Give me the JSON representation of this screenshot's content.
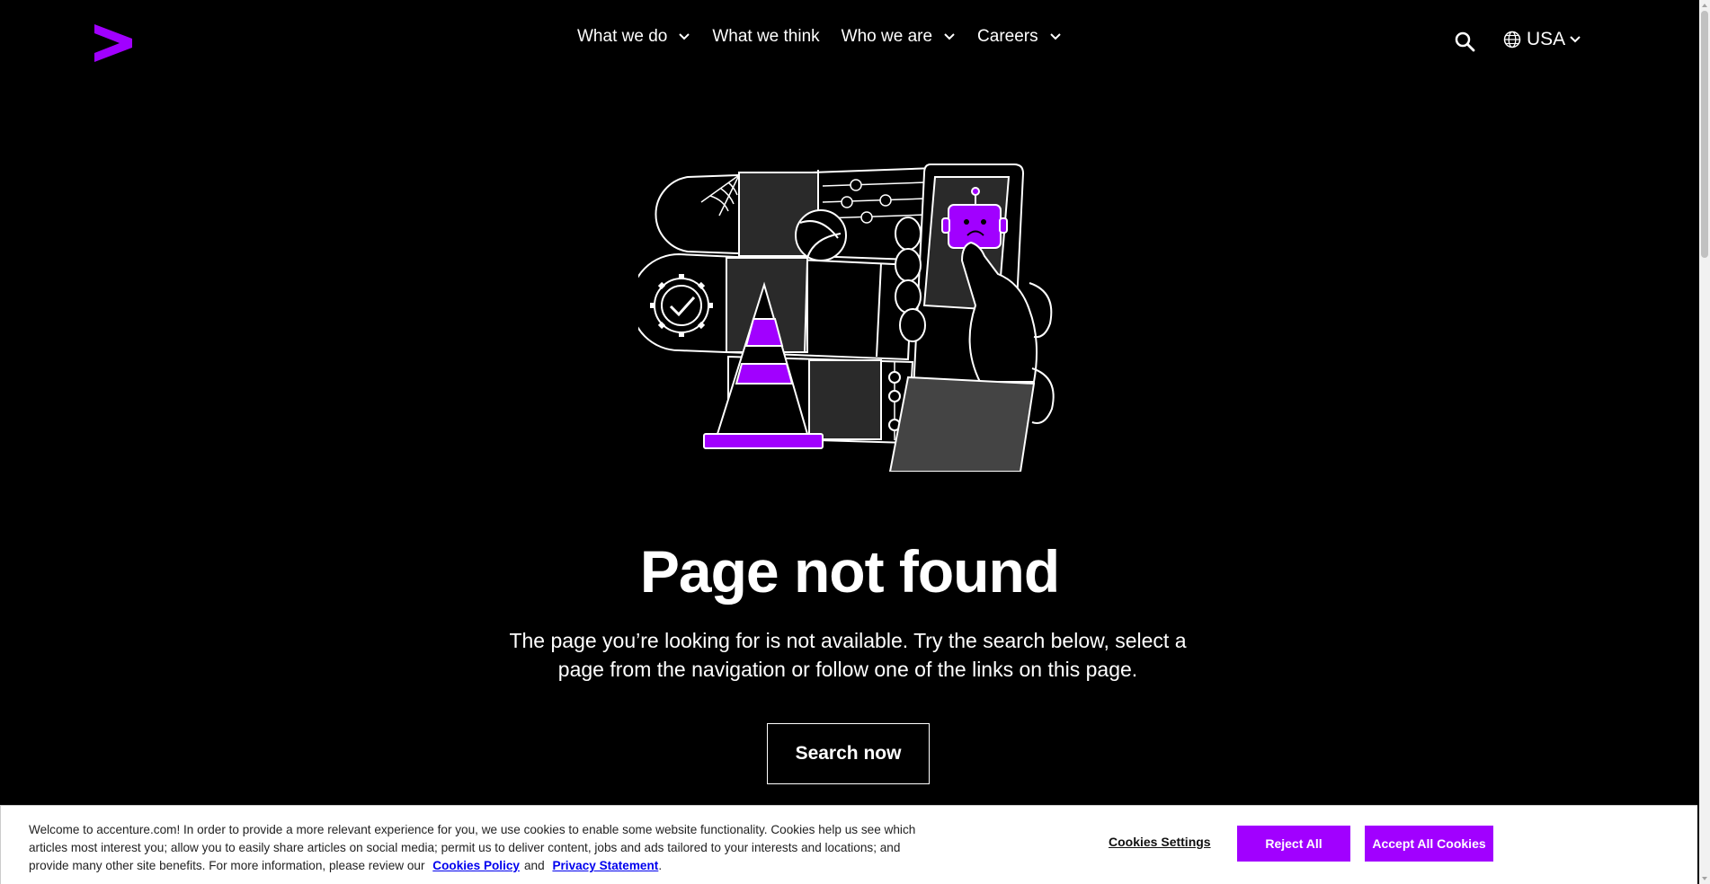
{
  "header": {
    "nav": [
      {
        "label": "What we do",
        "has_dropdown": true
      },
      {
        "label": "What we think",
        "has_dropdown": false
      },
      {
        "label": "Who we are",
        "has_dropdown": true
      },
      {
        "label": "Careers",
        "has_dropdown": true
      }
    ],
    "locale": "USA"
  },
  "main": {
    "title": "Page not found",
    "description": "The page you’re looking for is not available. Try the search below, select a page from the navigation or follow one of the links on this page.",
    "search_button": "Search now"
  },
  "cookie_banner": {
    "text": "Welcome to accenture.com! In order to provide a more relevant experience for you, we use cookies to enable some website functionality. Cookies help us see which articles most interest you; allow you to easily share articles on social media; permit us to deliver content, jobs and ads tailored to your interests and locations; and provide many other site benefits. For more information, please review our",
    "cookies_policy_link": "Cookies Policy",
    "and": "and",
    "privacy_link": "Privacy Statement",
    "period": ".",
    "settings_label": "Cookies Settings",
    "reject_label": "Reject All",
    "accept_label": "Accept All Cookies"
  },
  "colors": {
    "brand_purple": "#a100ff",
    "background": "#000000"
  }
}
